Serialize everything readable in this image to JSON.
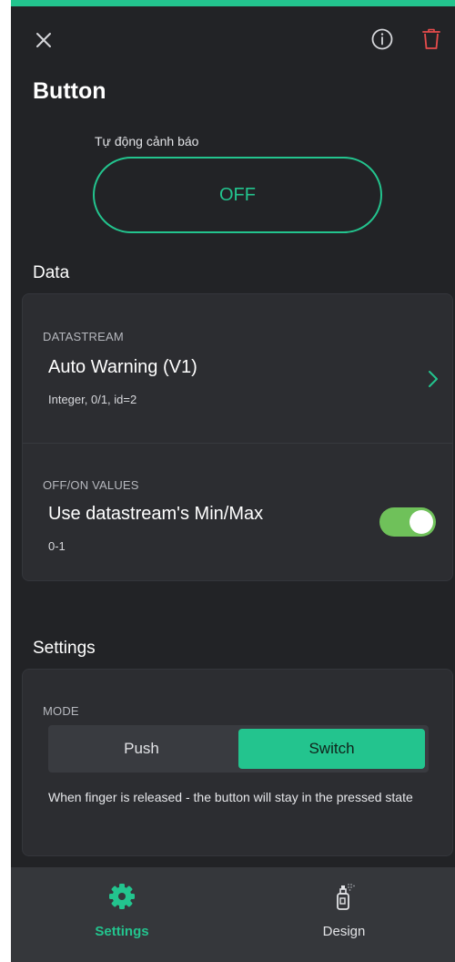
{
  "colors": {
    "accent": "#23c48e",
    "danger": "#e74c4c",
    "toggle_on": "#6fc15a",
    "background": "#222326",
    "card": "#2c2d31"
  },
  "header": {
    "close_icon": "close-icon",
    "info_icon": "info-icon",
    "delete_icon": "trash-icon"
  },
  "widget": {
    "title": "Button",
    "preview_label": "Tự động cảnh báo",
    "preview_state": "OFF"
  },
  "data_section": {
    "heading": "Data",
    "datastream": {
      "overline": "DATASTREAM",
      "name": "Auto Warning (V1)",
      "details": "Integer, 0/1, id=2"
    },
    "off_on_values": {
      "overline": "OFF/ON VALUES",
      "label": "Use datastream's Min/Max",
      "range": "0-1",
      "toggle_on": true
    }
  },
  "settings_section": {
    "heading": "Settings",
    "mode": {
      "overline": "MODE",
      "options": [
        "Push",
        "Switch"
      ],
      "selected": "Switch",
      "description": "When finger is released - the button will stay in the pressed state"
    }
  },
  "bottom_nav": {
    "items": [
      {
        "label": "Settings",
        "icon": "gear-icon",
        "active": true
      },
      {
        "label": "Design",
        "icon": "spray-can-icon",
        "active": false
      }
    ]
  }
}
